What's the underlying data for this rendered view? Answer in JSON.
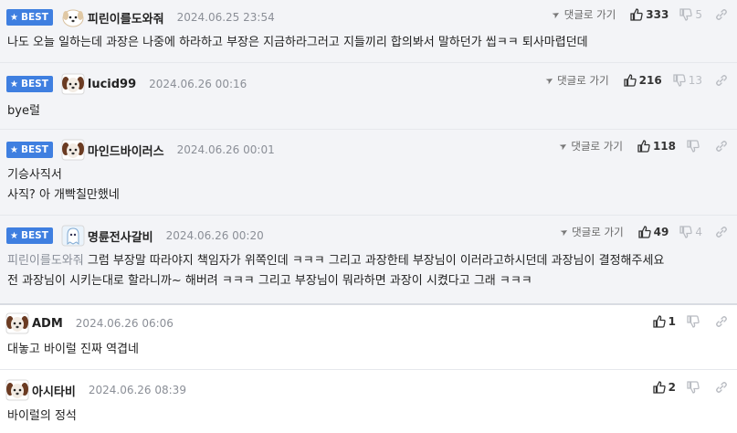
{
  "best_badge": "BEST",
  "reply_label": "댓글로 가기",
  "comments": [
    {
      "nick": "피린이를도와줘",
      "date": "2024.06.25 23:54",
      "likes": "333",
      "dislikes": "5",
      "lines": [
        "나도 오늘 일하는데 과장은 나중에 하라하고 부장은 지금하라그러고 지들끼리 합의봐서 말하던가 씹ㅋㅋ 퇴사마렵던데"
      ]
    },
    {
      "nick": "lucid99",
      "date": "2024.06.26 00:16",
      "likes": "216",
      "dislikes": "13",
      "lines": [
        "bye럴"
      ]
    },
    {
      "nick": "마인드바이러스",
      "date": "2024.06.26 00:01",
      "likes": "118",
      "dislikes": "",
      "lines": [
        "기승사직서",
        "사직? 아 개빡칠만했네"
      ]
    },
    {
      "nick": "명륜전사갈비",
      "date": "2024.06.26 00:20",
      "likes": "49",
      "dislikes": "4",
      "mention": "피린이를도와줘",
      "lines": [
        " 그럼 부장말 따라야지 책임자가 위쪽인데 ㅋㅋㅋ 그리고 과장한테 부장님이 이러라고하시던데 과장님이 결정해주세요",
        "전 과장님이 시키는대로 할라니까~ 해버려 ㅋㅋㅋ 그리고 부장님이 뭐라하면 과장이 시켰다고 그래 ㅋㅋㅋ"
      ]
    },
    {
      "nick": "ADM",
      "date": "2024.06.26 06:06",
      "likes": "1",
      "dislikes": "",
      "lines": [
        "대놓고 바이럴 진짜 역겹네"
      ]
    },
    {
      "nick": "아시타비",
      "date": "2024.06.26 08:39",
      "likes": "2",
      "dislikes": "",
      "lines": [
        "바이럴의 정석"
      ]
    }
  ]
}
